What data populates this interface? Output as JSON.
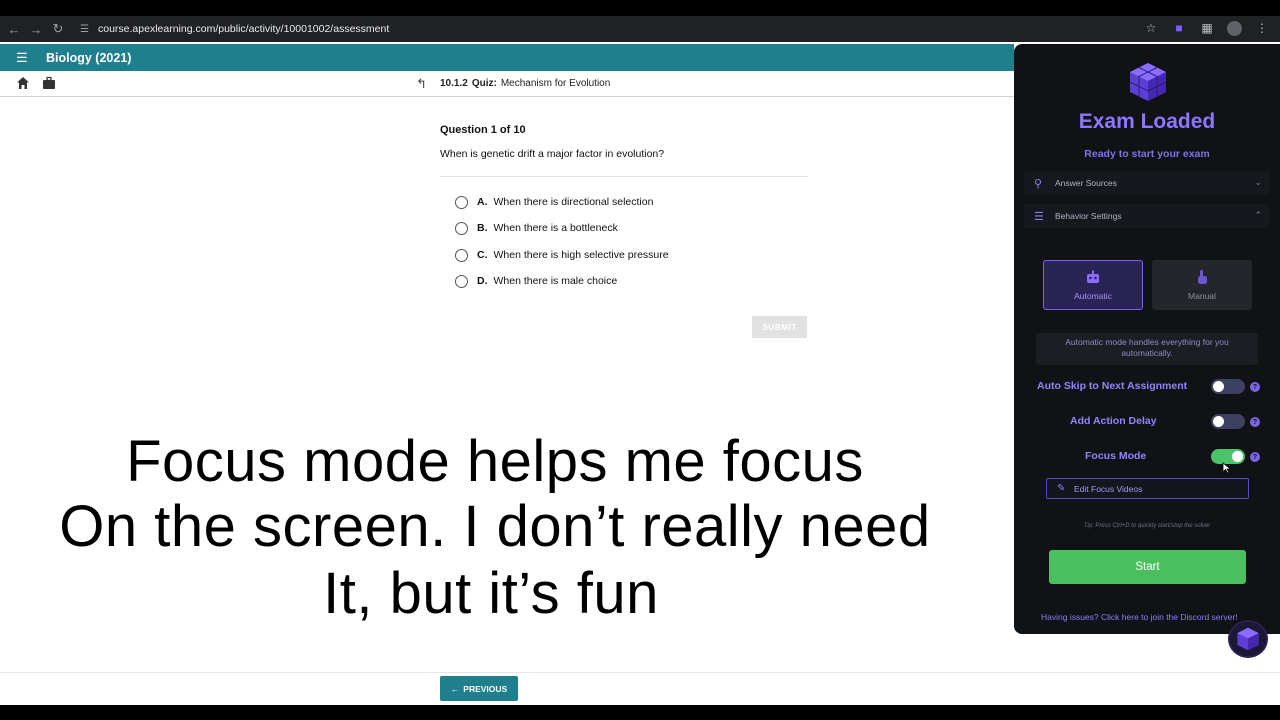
{
  "browser": {
    "url": "course.apexlearning.com/public/activity/10001002/assessment"
  },
  "header": {
    "course_title": "Biology (2021)"
  },
  "breadcrumb": {
    "code": "10.1.2",
    "type": "Quiz:",
    "title": "Mechanism for Evolution"
  },
  "quiz": {
    "question_number": "Question 1 of 10",
    "question_text": "When is genetic drift a major factor in evolution?",
    "options": [
      {
        "letter": "A.",
        "text": "When there is directional selection"
      },
      {
        "letter": "B.",
        "text": "When there is a bottleneck"
      },
      {
        "letter": "C.",
        "text": "When there is high selective pressure"
      },
      {
        "letter": "D.",
        "text": "When there is male choice"
      }
    ],
    "submit_label": "SUBMIT",
    "previous_label": "PREVIOUS"
  },
  "captions": [
    "Focus mode helps me focus",
    "On the screen. I don’t really need",
    "It, but it’s fun"
  ],
  "extension": {
    "title": "Exam Loaded",
    "subtitle": "Ready to start your exam",
    "sections": [
      {
        "label": "Answer Sources",
        "expanded": false
      },
      {
        "label": "Behavior Settings",
        "expanded": true
      }
    ],
    "modes": [
      {
        "label": "Automatic",
        "selected": true
      },
      {
        "label": "Manual",
        "selected": false
      }
    ],
    "mode_description_line1": "Automatic mode handles everything for you",
    "mode_description_line2": "automatically.",
    "settings": [
      {
        "label": "Auto Skip to Next Assignment",
        "enabled": false
      },
      {
        "label": "Add Action Delay",
        "enabled": false
      },
      {
        "label": "Focus Mode",
        "enabled": true
      }
    ],
    "help_glyph": "?",
    "edit_focus_label": "Edit Focus Videos",
    "tip": "Tip: Press Ctrl+D to quickly start/stop the solver",
    "start_label": "Start",
    "issues_link": "Having issues? Click here to join the Discord server!"
  },
  "colors": {
    "apex_teal": "#1f7f8c",
    "accent_purple": "#8f76ff",
    "toggle_on": "#4cc36a",
    "start_green": "#4bbf5e"
  }
}
